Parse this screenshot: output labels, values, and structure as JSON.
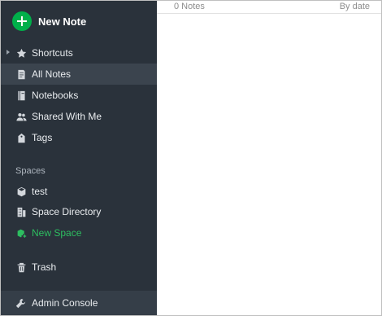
{
  "sidebar": {
    "new_note_label": "New Note",
    "items": [
      {
        "label": "Shortcuts",
        "icon": "star-icon"
      },
      {
        "label": "All Notes",
        "icon": "note-icon"
      },
      {
        "label": "Notebooks",
        "icon": "notebook-icon"
      },
      {
        "label": "Shared With Me",
        "icon": "people-icon"
      },
      {
        "label": "Tags",
        "icon": "tag-icon"
      }
    ],
    "spaces_title": "Spaces",
    "spaces": [
      {
        "label": "test",
        "icon": "cube-icon"
      },
      {
        "label": "Space Directory",
        "icon": "building-icon"
      },
      {
        "label": "New Space",
        "icon": "cube-plus-icon"
      }
    ],
    "trash_label": "Trash",
    "admin_label": "Admin Console"
  },
  "main": {
    "note_count": "0 Notes",
    "sort_label": "By date"
  },
  "colors": {
    "sidebar_bg": "#2a323b",
    "active_bg": "#3b444e",
    "accent_green": "#00b04a",
    "new_space_text": "#2dbe60"
  }
}
